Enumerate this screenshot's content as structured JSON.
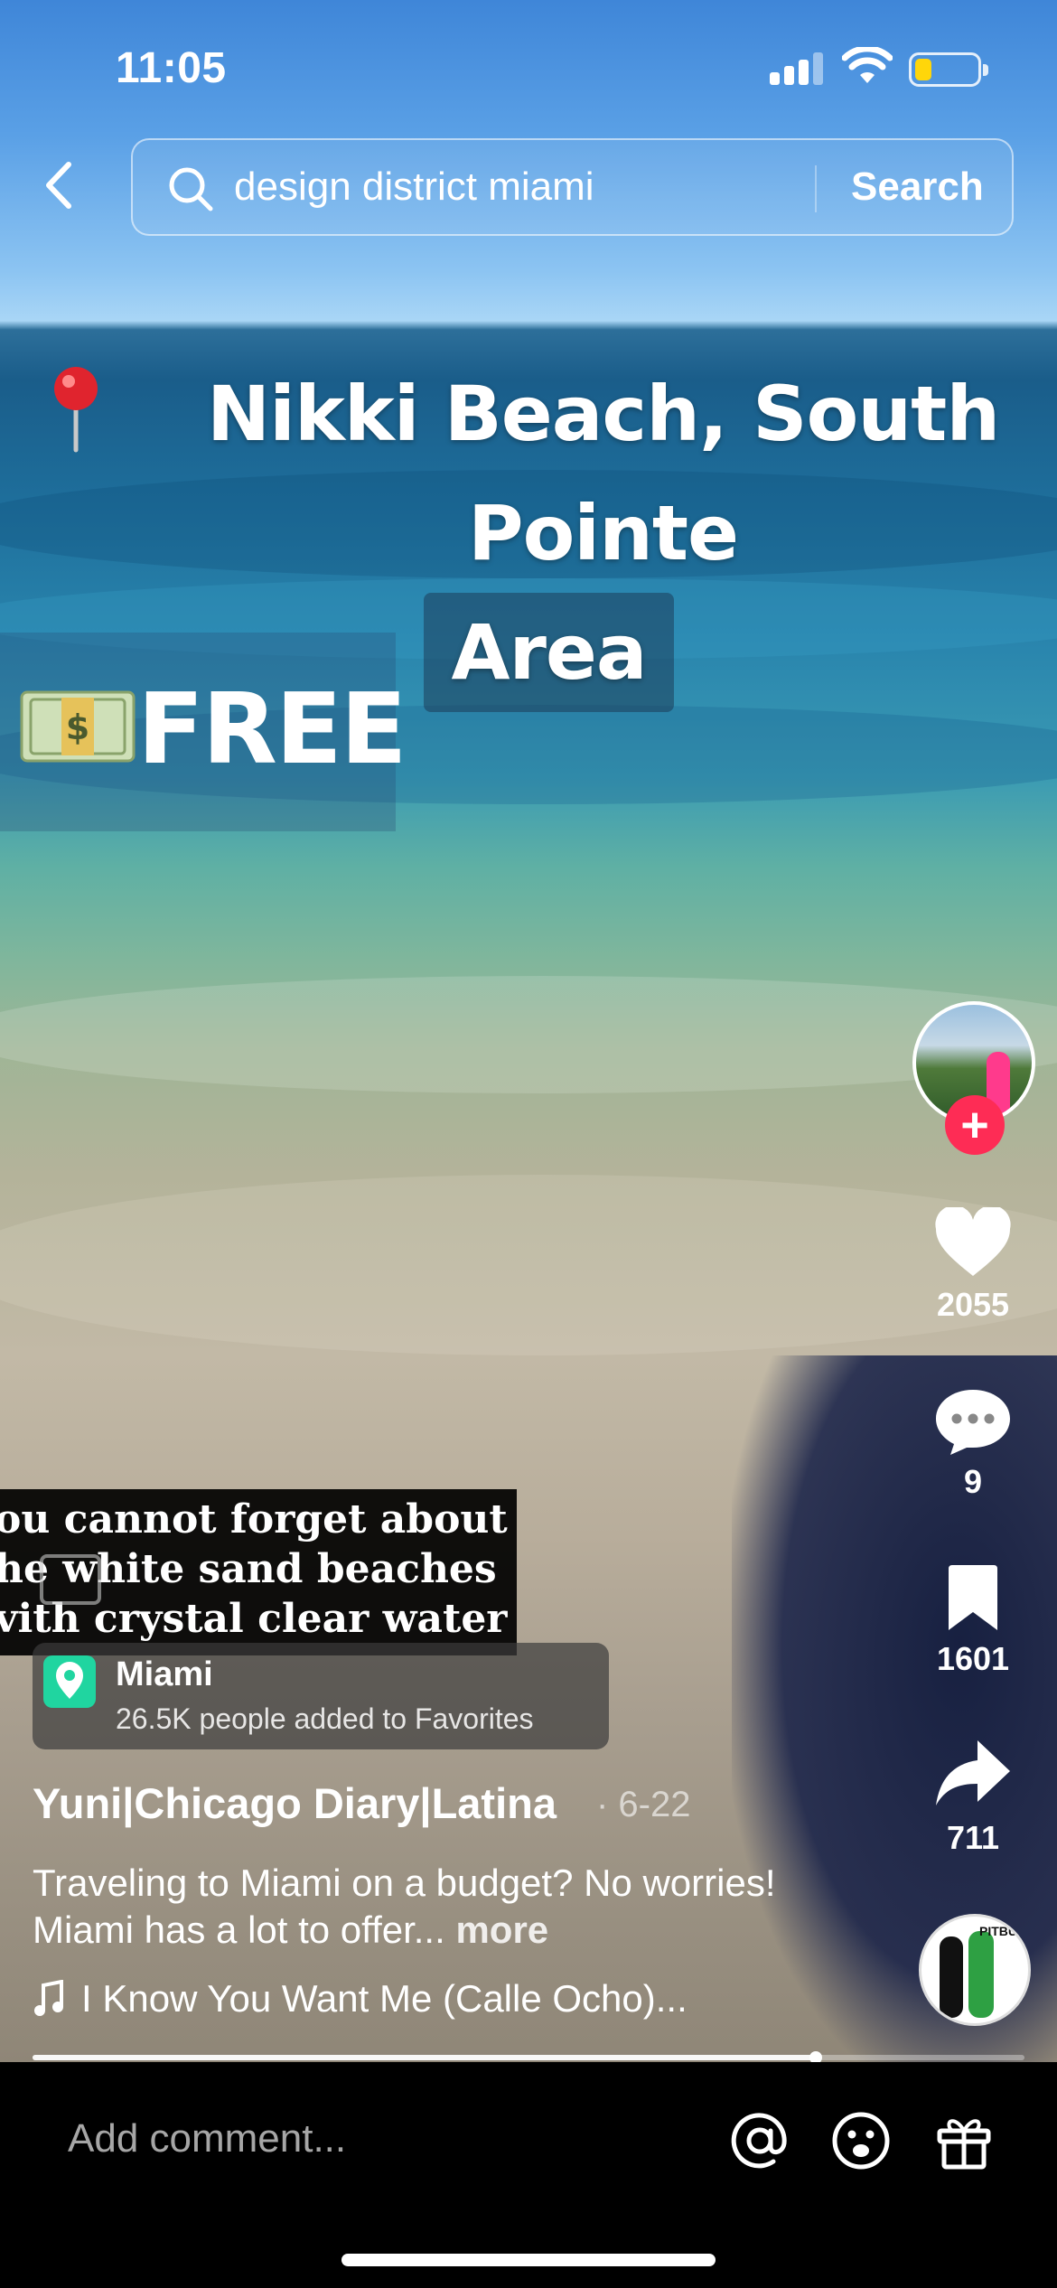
{
  "status_bar": {
    "time": "11:05"
  },
  "search": {
    "query": "design district miami",
    "button_label": "Search"
  },
  "overlay": {
    "title_line1": "Nikki Beach, South Pointe",
    "title_line2": "Area",
    "price": "FREE",
    "subtitle_lines": [
      "ou cannot forget about",
      "he white sand beaches",
      "vith crystal clear water"
    ]
  },
  "location": {
    "name": "Miami",
    "favorites": "26.5K people added to Favorites"
  },
  "post": {
    "author": "Yuni|Chicago Diary|Latina",
    "date": "· 6-22",
    "caption": "Traveling to Miami on a budget? No worries! Miami has a lot to offer...",
    "more_label": "more",
    "music": "I Know You Want Me (Calle Ocho)...",
    "progress": 0.79
  },
  "rail": {
    "likes": "2055",
    "comments": "9",
    "saves": "1601",
    "shares": "711",
    "disc_label": "PITBU"
  },
  "comment_bar": {
    "placeholder": "Add comment..."
  },
  "colors": {
    "follow": "#fe2c55",
    "location_pin": "#20d5a0",
    "battery_level": "#ffd60a"
  }
}
